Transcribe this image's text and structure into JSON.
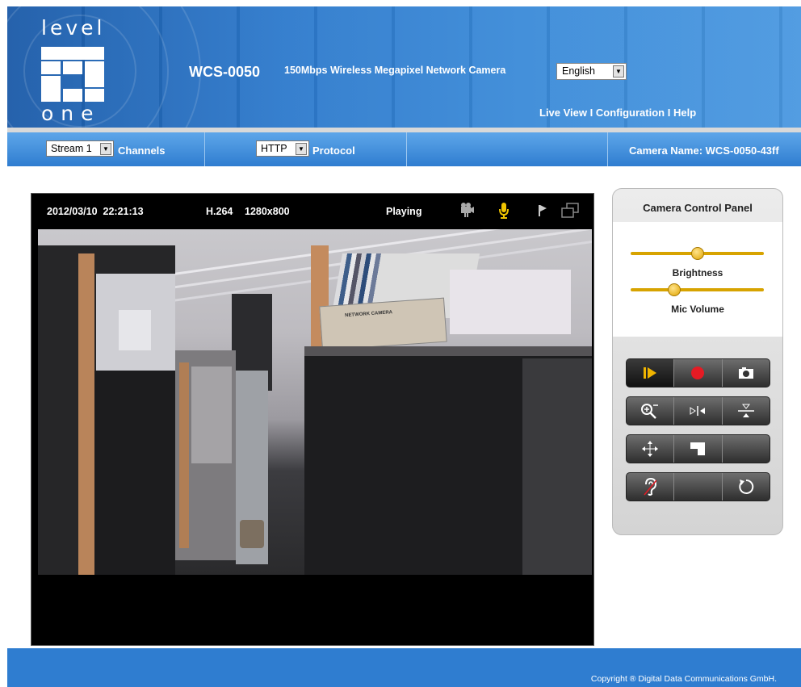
{
  "header": {
    "logo_top": "level",
    "logo_bottom": "one",
    "model": "WCS-0050",
    "description": "150Mbps Wireless Megapixel Network Camera",
    "language": "English",
    "nav": [
      "Live View",
      "Configuration",
      "Help"
    ],
    "nav_separator": "I"
  },
  "toolbar": {
    "stream_value": "Stream 1",
    "stream_label": "Channels",
    "protocol_value": "HTTP",
    "protocol_label": "Protocol",
    "camera_name": "Camera Name: WCS-0050-43ff"
  },
  "video": {
    "timestamp": "2012/03/10  22:21:13",
    "codec": "H.264",
    "resolution": "1280x800",
    "status": "Playing",
    "box_label": "NETWORK CAMERA"
  },
  "panel": {
    "title": "Camera Control Panel",
    "brightness_label": "Brightness",
    "brightness_level": 0.5,
    "mic_label": "Mic Volume",
    "mic_level": 0.31,
    "buttons": [
      [
        "play-icon",
        "record-icon",
        "snapshot-icon"
      ],
      [
        "zoom-icon",
        "flip-horizontal-icon",
        "flip-vertical-icon"
      ],
      [
        "move-icon",
        "corner-icon",
        "blank"
      ],
      [
        "mute-audio-icon",
        "blank",
        "refresh-icon"
      ]
    ]
  },
  "colors": {
    "header_blue": "#2c79cc",
    "accent_gold": "#d7a300",
    "record_red": "#e51b24"
  },
  "footer": {
    "copyright": "Copyright ® Digital Data Communications GmbH."
  }
}
